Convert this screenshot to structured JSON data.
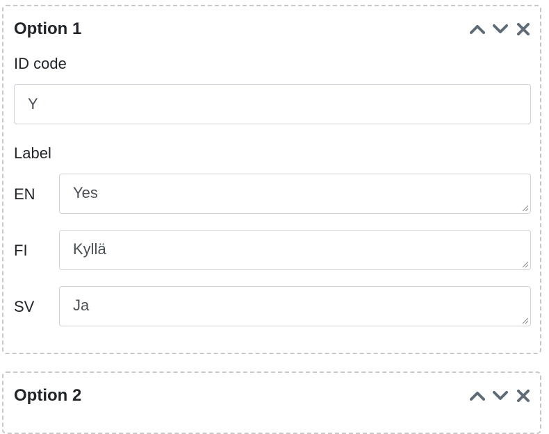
{
  "options": [
    {
      "title": "Option 1",
      "id_code_label": "ID code",
      "id_code_value": "Y",
      "label_heading": "Label",
      "labels": [
        {
          "lang": "EN",
          "value": "Yes"
        },
        {
          "lang": "FI",
          "value": "Kyllä"
        },
        {
          "lang": "SV",
          "value": "Ja"
        }
      ]
    },
    {
      "title": "Option 2"
    }
  ],
  "icons": {
    "move_up": "chevron-up-icon",
    "move_down": "chevron-down-icon",
    "remove": "close-icon"
  },
  "colors": {
    "icon": "#5f6b76",
    "border_dashed": "#c8c8c8",
    "input_border": "#ced4da"
  }
}
